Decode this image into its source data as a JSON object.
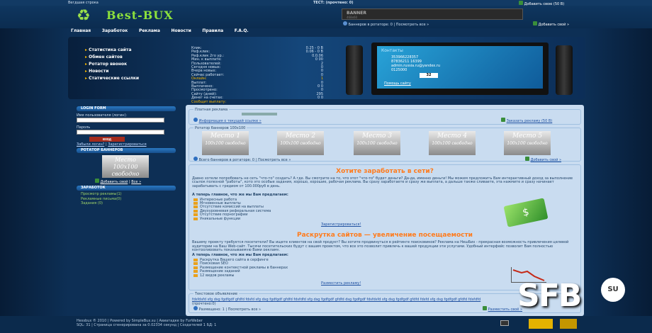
{
  "top": {
    "left": "Вегдшая строка",
    "center": "ТЕСТ: (прочтено: 0)",
    "right": "Добавить свою (50 В)"
  },
  "logo": "Best-BUX",
  "banner": {
    "title": "BANNER",
    "subtitle": "468x60",
    "caption": "Баннеров в ротаторе: 0 | Посмотреть все »",
    "add": "Добавить свой »"
  },
  "nav": [
    "Главная",
    "Заработок",
    "Реклама",
    "Новости",
    "Правила",
    "F.A.Q."
  ],
  "hero_menu": [
    "Статистика сайта",
    "Обмен сайтов",
    "Ротатор ввонок",
    "Новости",
    "Статические ссылки"
  ],
  "stats": [
    {
      "k": "Клик:",
      "v": "0.25 - 0 В"
    },
    {
      "k": "Реф.клик:",
      "v": "0.06 - 0 В"
    },
    {
      "k": "Реф.клик 2го ур.:",
      "v": "0.0.06"
    },
    {
      "k": "Мин. к выплате:",
      "v": "0 00"
    },
    {
      "k": "Пользователей:",
      "v": "2"
    },
    {
      "k": "Сегодня новых:",
      "v": "0"
    },
    {
      "k": "Вчера новых:",
      "v": "0"
    },
    {
      "k": "Сейчас работает:",
      "v": "0"
    },
    {
      "k": "Онлайн:",
      "v": "1"
    },
    {
      "k": "Выплат:",
      "v": "0"
    },
    {
      "k": "Выплачено:",
      "v": "0 0"
    },
    {
      "k": "Просмотрено:",
      "v": "0"
    },
    {
      "k": "Сайту (дней):",
      "v": "295"
    },
    {
      "k": "Денег на счетах:",
      "v": "0 0"
    },
    {
      "k": "Сообщит выплату:",
      "v": ""
    }
  ],
  "tv": {
    "title": "Контакты",
    "lines": [
      "353966228357",
      "87836211 16399",
      "admin.russia.ru@yandex.ru",
      "0125000"
    ],
    "count": "32",
    "footer": "Помощь сайту"
  },
  "login": {
    "title": "LOGIN FORM",
    "user_label": "Имя пользователя (логин):",
    "pass_label": "Пароль",
    "button": "вход",
    "forgot": "Забыли логин?",
    "register": "Зарегистрироваться"
  },
  "rotator": {
    "title": "РОТАТОР БАННЕРОВ",
    "ph": "Место 100х100 свободно",
    "add": "Добавить свой",
    "all": "Все »"
  },
  "earn": {
    "title": "ЗАРАБОТОК",
    "items": [
      "Просмотр рекламы(1)",
      "Рекламные письма(0)",
      "Задания (0)"
    ]
  },
  "paid": {
    "legend": "Платная реклама",
    "link": "Информация о текущей ссылке »",
    "order": "Заказать рекламу (50 В)"
  },
  "places": {
    "legend": "Ротатор баннеров 100x100",
    "items": [
      {
        "t": "Место 1",
        "s": "100x100 свободно"
      },
      {
        "t": "Место 2",
        "s": "100x100 свободно"
      },
      {
        "t": "Место 3",
        "s": "100x100 свободно"
      },
      {
        "t": "Место 4",
        "s": "100x100 свободно"
      },
      {
        "t": "Место 5",
        "s": "100x100 свободно"
      }
    ],
    "caption": "Всего баннеров в ротаторе: 0 | Посмотреть все »",
    "add": "Добавить свой »"
  },
  "promo1": {
    "title": "Хотите заработать в сети?",
    "text": "Давно хотели попробовать не сеть \"что-то\" создать? А где. Вы смотрите на то, что этот \"что-то\" будет деньги? Да-да, именно деньги! Мы можем предложить Вам интерактивный доход за выполнение ссылок полезной \"работы\", кото это особые задания, хорошо, хорошие, рабочая реклама. Вы сразу заработаете и сразу же выплата, а дальше также сливаете, эта нажмите и сразу начинает зарабатывать с гредиом от 100.000руб в день.",
    "lead": "А теперь главное, что же мы Вам предлагаем:",
    "items": [
      "Интересные работа",
      "Мгновенные выплаты",
      "Отсутствие комиссий на выплаты",
      "Двухуровневая реферальная система",
      "Отсутствие порнографии",
      "Уникальные функции"
    ],
    "link": "Зарегистрироваться!"
  },
  "promo2": {
    "title": "Раскрутка сайтов — увеличение посещаемости",
    "text": "Вашему проекту требуется посетители? Вы ищете клиентов на свой продукт? Вы хотите продвинуться в рейтинге поисковиков? Реклама на НешБих - прекрасная возможность привлечения целевой аудитории на Ваш Web-сайт. Тысячи посетительских будут с вашим проектом, что все это позволит привлечь к вашей продукции эти услугами. Удобный интерфейс позволит Вам полностью контролировать показываемую Вами рекламу.",
    "lead": "А теперь главное, что же мы Вам предлагаем:",
    "items": [
      "Раскрутка Вашего сайта в серфинге",
      "Поисковая SEO",
      "Размещение контекстной рекламы в баннерах",
      "Размещение заданий",
      "12 видов рекламы"
    ],
    "link": "Разместить рекламу!"
  },
  "text_ads": {
    "legend": "Текстовое объявление",
    "text": "fdsfdsfd sfg dsg fgdfgdf gfdfd fdsfd sfg dsg fgdfgdf gfdfd fdsfdfd sfg dsg fgdfgdf gfdfd dsg fgdfgdf fdsfdsfd sfg dsg fgdfgdf gfdfd fdsfd sfg dsg fgdfgdf gfdfd fdsfdfd",
    "sub": "(прочтено:0)",
    "caption": "Размещено: 1 | Посмотреть все »",
    "add": "Разместить своё »"
  },
  "footer": {
    "line1": "Hessbux ® 2010 | Powered by SimpleBux.su | Авиатадке by FurWeber",
    "line2": "SQL: 31 | Страница сгенерирована за 0.02334 секунд | Создателей 1 БД: 1",
    "badge": "SFB",
    "badge_su": "SU"
  }
}
